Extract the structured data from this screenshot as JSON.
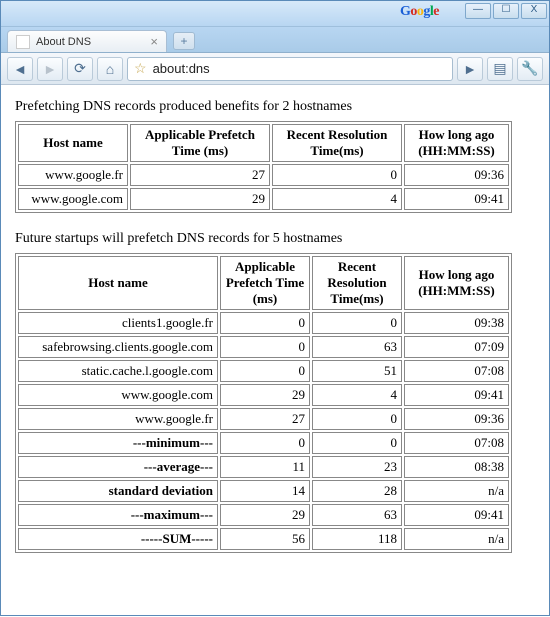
{
  "window": {
    "google_logo": true,
    "buttons": {
      "min": "—",
      "max": "☐",
      "close": "X"
    }
  },
  "tab": {
    "title": "About DNS",
    "close": "×",
    "newtab": "+"
  },
  "toolbar": {
    "back": "◄",
    "forward": "►",
    "reload": "⟳",
    "home": "⌂",
    "star": "☆",
    "url": "about:dns",
    "go": "►",
    "page": "▤",
    "wrench": "🔧"
  },
  "section1": {
    "caption": "Prefetching DNS records produced benefits for 2 hostnames",
    "headers": [
      "Host name",
      "Applicable Prefetch Time (ms)",
      "Recent Resolution Time(ms)",
      "How long ago (HH:MM:SS)"
    ],
    "rows": [
      {
        "host": "www.google.fr",
        "prefetch": "27",
        "resolution": "0",
        "ago": "09:36"
      },
      {
        "host": "www.google.com",
        "prefetch": "29",
        "resolution": "4",
        "ago": "09:41"
      }
    ]
  },
  "section2": {
    "caption": "Future startups will prefetch DNS records for 5 hostnames",
    "headers": [
      "Host name",
      "Applicable Prefetch Time (ms)",
      "Recent Resolution Time(ms)",
      "How long ago (HH:MM:SS)"
    ],
    "rows": [
      {
        "host": "clients1.google.fr",
        "prefetch": "0",
        "resolution": "0",
        "ago": "09:38",
        "bold": false
      },
      {
        "host": "safebrowsing.clients.google.com",
        "prefetch": "0",
        "resolution": "63",
        "ago": "07:09",
        "bold": false
      },
      {
        "host": "static.cache.l.google.com",
        "prefetch": "0",
        "resolution": "51",
        "ago": "07:08",
        "bold": false
      },
      {
        "host": "www.google.com",
        "prefetch": "29",
        "resolution": "4",
        "ago": "09:41",
        "bold": false
      },
      {
        "host": "www.google.fr",
        "prefetch": "27",
        "resolution": "0",
        "ago": "09:36",
        "bold": false
      },
      {
        "host": "---minimum---",
        "prefetch": "0",
        "resolution": "0",
        "ago": "07:08",
        "bold": true
      },
      {
        "host": "---average---",
        "prefetch": "11",
        "resolution": "23",
        "ago": "08:38",
        "bold": true
      },
      {
        "host": "standard deviation",
        "prefetch": "14",
        "resolution": "28",
        "ago": "n/a",
        "bold": true
      },
      {
        "host": "---maximum---",
        "prefetch": "29",
        "resolution": "63",
        "ago": "09:41",
        "bold": true
      },
      {
        "host": "-----SUM-----",
        "prefetch": "56",
        "resolution": "118",
        "ago": "n/a",
        "bold": true
      }
    ]
  }
}
